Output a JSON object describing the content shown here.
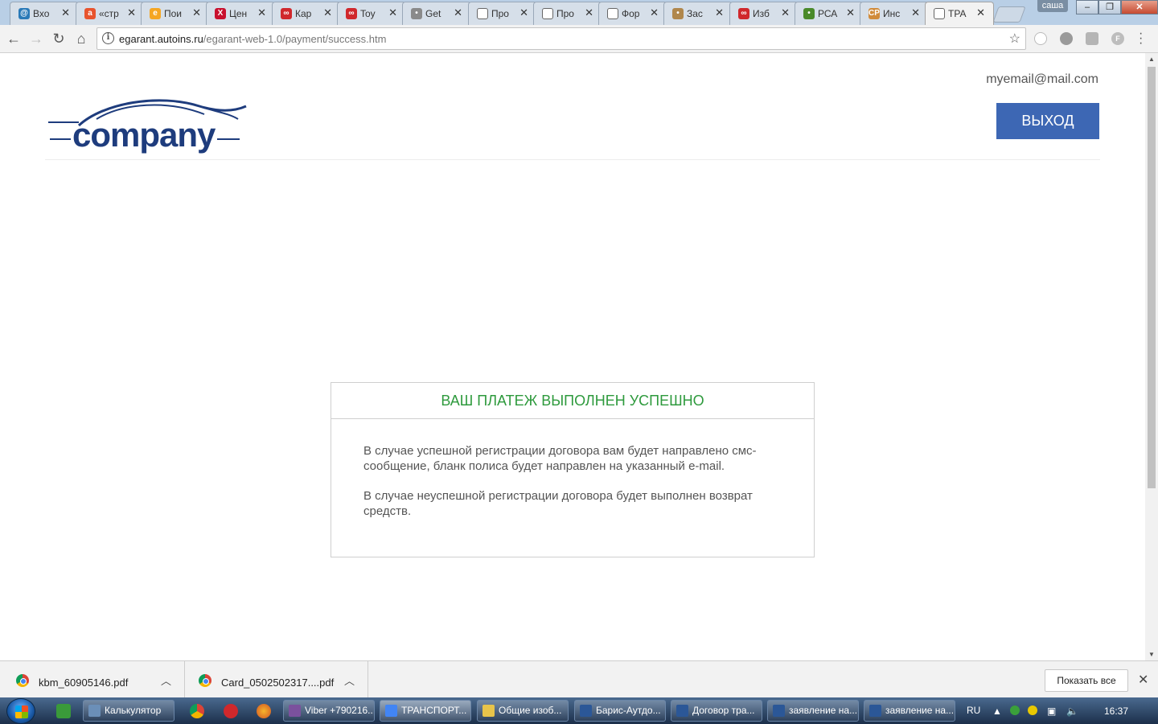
{
  "browser": {
    "tabs": [
      {
        "label": "Вхо",
        "favicon_color": "#2a7ab8",
        "favicon_glyph": "@"
      },
      {
        "label": "«стр",
        "favicon_color": "#e8542e",
        "favicon_glyph": "a"
      },
      {
        "label": "Пои",
        "favicon_color": "#f5a623",
        "favicon_glyph": "e"
      },
      {
        "label": "Цен",
        "favicon_color": "#c8102e",
        "favicon_glyph": "X"
      },
      {
        "label": "Кар",
        "favicon_color": "#d0282c",
        "favicon_glyph": "∞"
      },
      {
        "label": "Toy",
        "favicon_color": "#d0282c",
        "favicon_glyph": "∞"
      },
      {
        "label": "Get",
        "favicon_color": "#8a8a8a",
        "favicon_glyph": "•"
      },
      {
        "label": "Про",
        "favicon_color": "#ffffff",
        "favicon_glyph": ""
      },
      {
        "label": "Про",
        "favicon_color": "#ffffff",
        "favicon_glyph": ""
      },
      {
        "label": "Фор",
        "favicon_color": "#ffffff",
        "favicon_glyph": ""
      },
      {
        "label": "Зас",
        "favicon_color": "#b0874c",
        "favicon_glyph": "•"
      },
      {
        "label": "Изб",
        "favicon_color": "#d0282c",
        "favicon_glyph": "∞"
      },
      {
        "label": "РСА",
        "favicon_color": "#4a8a2a",
        "favicon_glyph": "•"
      },
      {
        "label": "Инс",
        "favicon_color": "#d18b3a",
        "favicon_glyph": "CP"
      },
      {
        "label": "ТРА",
        "favicon_color": "#ffffff",
        "favicon_glyph": "",
        "active": true
      }
    ],
    "window_user": "саша",
    "url_host": "egarant.autoins.ru",
    "url_path": "/egarant-web-1.0/payment/success.htm"
  },
  "header": {
    "email": "myemail@mail.com",
    "logout_label": "ВЫХОД",
    "logo_text": "company",
    "brand_color": "#1e3c7d",
    "button_color": "#3d67b4"
  },
  "card": {
    "title": "ВАШ ПЛАТЕЖ ВЫПОЛНЕН УСПЕШНО",
    "title_color": "#2e9a3d",
    "paragraph1": "В случае успешной регистрации договора вам будет направлено смс-сообщение, бланк полиса будет направлен на указанный e-mail.",
    "paragraph2": "В случае неуспешной регистрации договора будет выполнен возврат средств."
  },
  "downloads": {
    "items": [
      {
        "filename": "kbm_60905146.pdf"
      },
      {
        "filename": "Card_0502502317....pdf"
      }
    ],
    "show_all_label": "Показать все"
  },
  "taskbar": {
    "items": [
      {
        "label": "Калькулятор",
        "icon_color": "#6b8fb8"
      },
      {
        "label": "Viber +790216...",
        "icon_color": "#7b519d"
      },
      {
        "label": "ТРАНСПОРТ...",
        "icon_color": "#4285f4",
        "active": true
      },
      {
        "label": "Общие изоб...",
        "icon_color": "#e8c44a"
      },
      {
        "label": "Барис-Аутдо...",
        "icon_color": "#2b5797"
      },
      {
        "label": "Договор тра...",
        "icon_color": "#2b5797"
      },
      {
        "label": "заявление на...",
        "icon_color": "#2b5797"
      },
      {
        "label": "заявление на...",
        "icon_color": "#2b5797"
      }
    ],
    "language": "RU",
    "time": "16:37"
  }
}
